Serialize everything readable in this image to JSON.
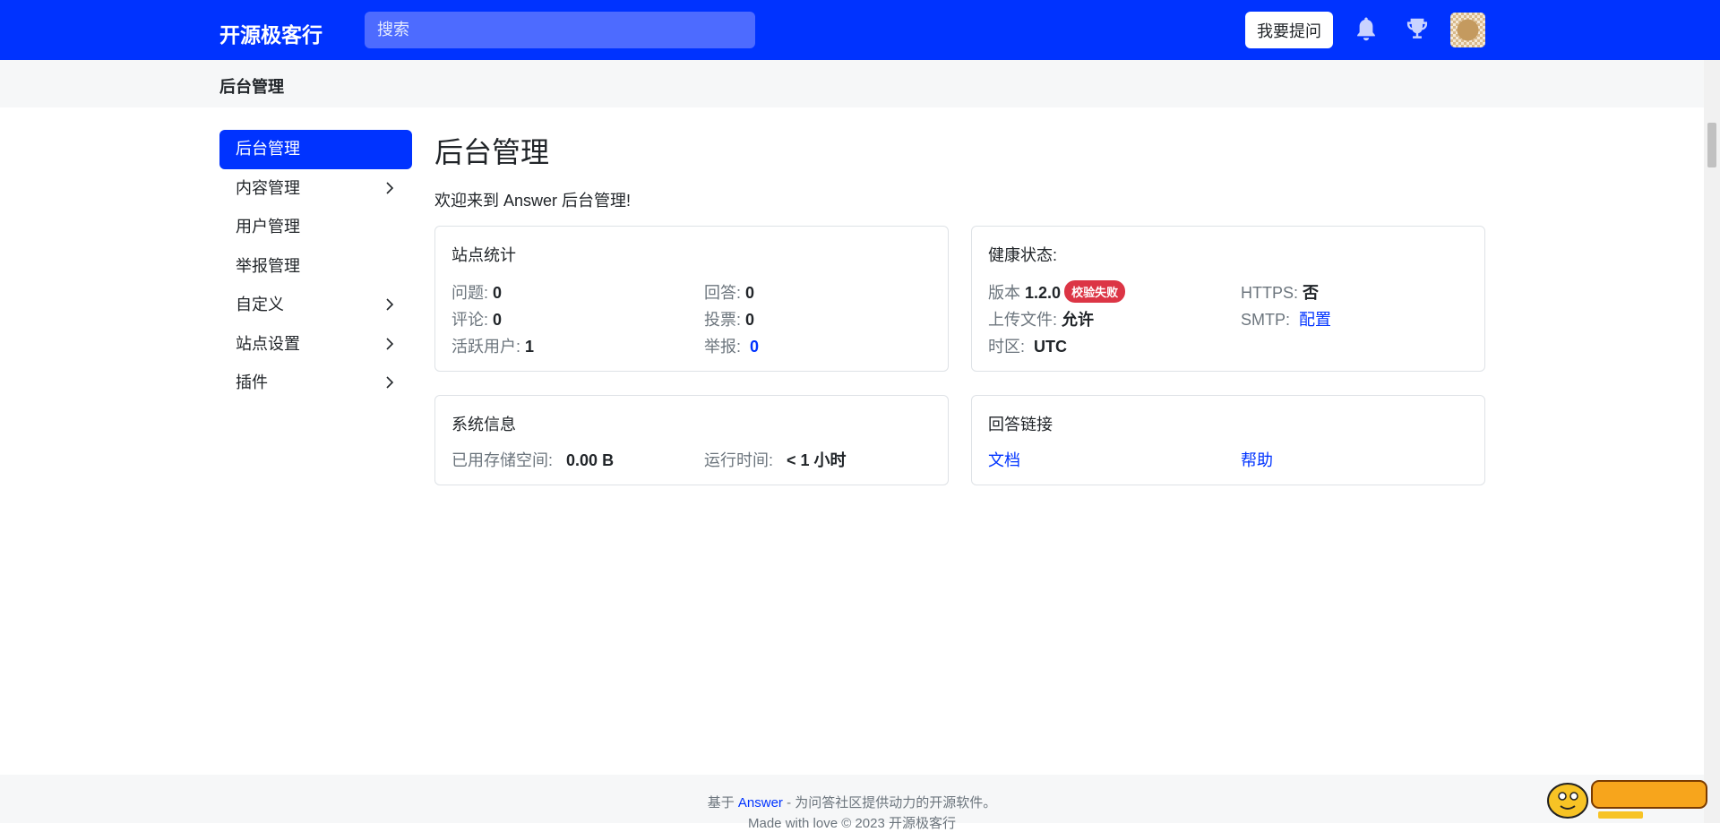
{
  "header": {
    "brand": "开源极客行",
    "search_placeholder": "搜索",
    "ask_button": "我要提问"
  },
  "breadcrumb": {
    "title": "后台管理"
  },
  "sidebar": {
    "items": [
      {
        "label": "后台管理",
        "active": true,
        "has_children": false
      },
      {
        "label": "内容管理",
        "active": false,
        "has_children": true
      },
      {
        "label": "用户管理",
        "active": false,
        "has_children": false
      },
      {
        "label": "举报管理",
        "active": false,
        "has_children": false
      },
      {
        "label": "自定义",
        "active": false,
        "has_children": true
      },
      {
        "label": "站点设置",
        "active": false,
        "has_children": true
      },
      {
        "label": "插件",
        "active": false,
        "has_children": true
      }
    ]
  },
  "main": {
    "title": "后台管理",
    "welcome": "欢迎来到 Answer 后台管理!"
  },
  "site_stats": {
    "title": "站点统计",
    "questions_label": "问题:",
    "questions_value": "0",
    "answers_label": "回答:",
    "answers_value": "0",
    "comments_label": "评论:",
    "comments_value": "0",
    "votes_label": "投票:",
    "votes_value": "0",
    "active_users_label": "活跃用户:",
    "active_users_value": "1",
    "reports_label": "举报:",
    "reports_value": "0"
  },
  "health": {
    "title": "健康状态:",
    "version_label": "版本",
    "version_value": "1.2.0",
    "version_badge": "校验失败",
    "https_label": "HTTPS:",
    "https_value": "否",
    "upload_label": "上传文件:",
    "upload_value": "允许",
    "smtp_label": "SMTP:",
    "smtp_link": "配置",
    "timezone_label": "时区:",
    "timezone_value": "UTC"
  },
  "system_info": {
    "title": "系统信息",
    "storage_label": "已用存储空间:",
    "storage_value": "0.00 B",
    "uptime_label": "运行时间:",
    "uptime_value": "< 1 小时"
  },
  "answer_links": {
    "title": "回答链接",
    "docs": "文档",
    "help": "帮助"
  },
  "footer": {
    "prefix": "基于",
    "link": "Answer",
    "suffix": "- 为问答社区提供动力的开源软件。",
    "line2": "Made with love © 2023 开源极客行"
  },
  "colors": {
    "primary": "#0033ff",
    "danger": "#dc3545"
  }
}
